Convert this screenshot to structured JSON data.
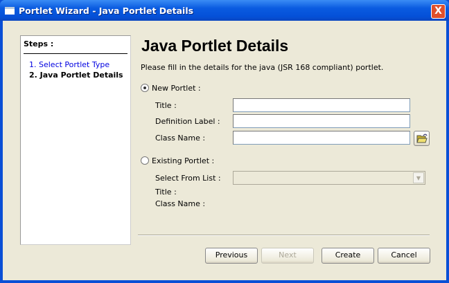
{
  "window": {
    "title": "Portlet Wizard - Java Portlet Details",
    "close_label": "X"
  },
  "steps": {
    "heading": "Steps :",
    "items": [
      {
        "label": "1. Select Portlet Type"
      },
      {
        "label": "2. Java Portlet Details"
      }
    ]
  },
  "page": {
    "title": "Java Portlet Details",
    "description": "Please fill in the details for the java (JSR 168 compliant) portlet."
  },
  "new_portlet": {
    "label": "New Portlet :",
    "selected": true,
    "title_label": "Title :",
    "title_value": "",
    "definition_label": "Definition Label :",
    "definition_value": "",
    "class_label": "Class Name :",
    "class_value": ""
  },
  "existing_portlet": {
    "label": "Existing Portlet :",
    "selected": false,
    "select_label": "Select From List :",
    "select_value": "",
    "title_label": "Title :",
    "class_label": "Class Name :"
  },
  "buttons": {
    "previous": "Previous",
    "next": "Next",
    "create": "Create",
    "cancel": "Cancel"
  }
}
